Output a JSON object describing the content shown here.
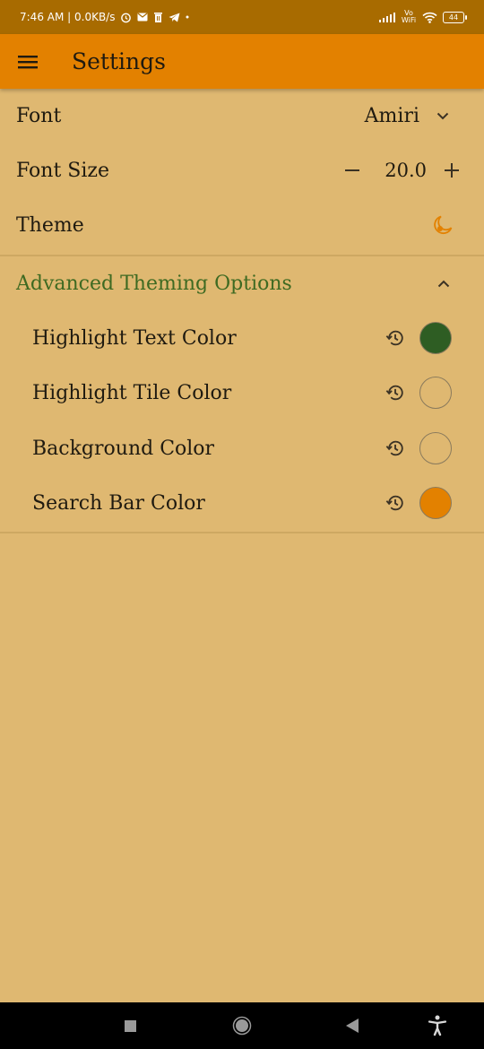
{
  "status_bar": {
    "time_text": "7:46 AM | 0.0KB/s",
    "network_label": "Vo WiFi",
    "battery_level": "44"
  },
  "app_bar": {
    "title": "Settings"
  },
  "settings": {
    "font": {
      "label": "Font",
      "value": "Amiri"
    },
    "font_size": {
      "label": "Font Size",
      "value": "20.0",
      "minus": "−",
      "plus": "+"
    },
    "theme": {
      "label": "Theme",
      "icon": "moon-icon"
    }
  },
  "advanced": {
    "title": "Advanced Theming Options",
    "expanded": true,
    "items": [
      {
        "label": "Highlight Text Color",
        "color": "#2E5D23",
        "filled": true
      },
      {
        "label": "Highlight Tile Color",
        "color": "#DFB871",
        "filled": false
      },
      {
        "label": "Background Color",
        "color": "#DFB871",
        "filled": false
      },
      {
        "label": "Search Bar Color",
        "color": "#E38100",
        "filled": true
      }
    ]
  },
  "colors": {
    "status_bar": "#A86B00",
    "app_bar": "#E38100",
    "background": "#DFB871",
    "section_title": "#3E6A22",
    "theme_icon": "#E38100"
  },
  "nav_bar": {
    "buttons": [
      "recents-square-icon",
      "home-circle-icon",
      "back-triangle-icon",
      "accessibility-icon"
    ]
  }
}
